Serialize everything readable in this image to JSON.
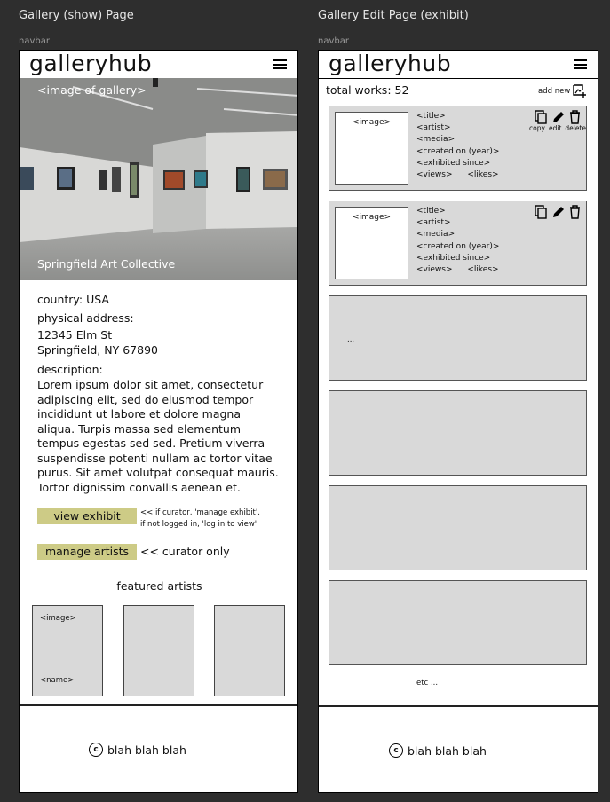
{
  "frames": {
    "left_title": "Gallery (show) Page",
    "right_title": "Gallery Edit Page (exhibit)",
    "navbar_label": "navbar"
  },
  "app": {
    "logo": "galleryhub"
  },
  "show": {
    "hero_placeholder": "<image of gallery>",
    "gallery_name": "Springfield Art Collective",
    "country": "country: USA",
    "address_label": "physical address:",
    "address_line1": "12345 Elm St",
    "address_line2": "Springfield, NY 67890",
    "description_label": "description:",
    "description": "Lorem ipsum dolor sit amet, consectetur adipiscing elit, sed do eiusmod tempor incididunt ut labore et dolore magna aliqua. Turpis massa sed elementum tempus egestas sed sed. Pretium viverra suspendisse potenti nullam ac tortor vitae purus. Sit amet volutpat consequat mauris. Tortor dignissim convallis aenean et.",
    "view_exhibit_button": "view exhibit",
    "view_exhibit_note_1": "<< if curator, 'manage exhibit'.",
    "view_exhibit_note_2": "if not logged in, 'log in to view'",
    "manage_artists_button": "manage artists",
    "manage_artists_note": "<< curator only",
    "featured_title": "featured artists",
    "featured_image": "<image>",
    "featured_name": "<name>"
  },
  "edit": {
    "total_works": "total works: 52",
    "add_new": "add new",
    "works": [
      {
        "image": "<image>",
        "title": "<title>",
        "artist": "<artist>",
        "media": "<media>",
        "created": "<created on (year)>",
        "exhibited": "<exhibited since>",
        "views": "<views>",
        "likes": "<likes>"
      },
      {
        "image": "<image>",
        "title": "<title>",
        "artist": "<artist>",
        "media": "<media>",
        "created": "<created on (year)>",
        "exhibited": "<exhibited since>",
        "views": "<views>",
        "likes": "<likes>"
      }
    ],
    "action_copy": "copy",
    "action_edit": "edit",
    "action_delete": "delete",
    "ellipsis": "...",
    "etc": "etc ..."
  },
  "footer": {
    "copyright_symbol": "c",
    "text": "blah blah blah"
  }
}
